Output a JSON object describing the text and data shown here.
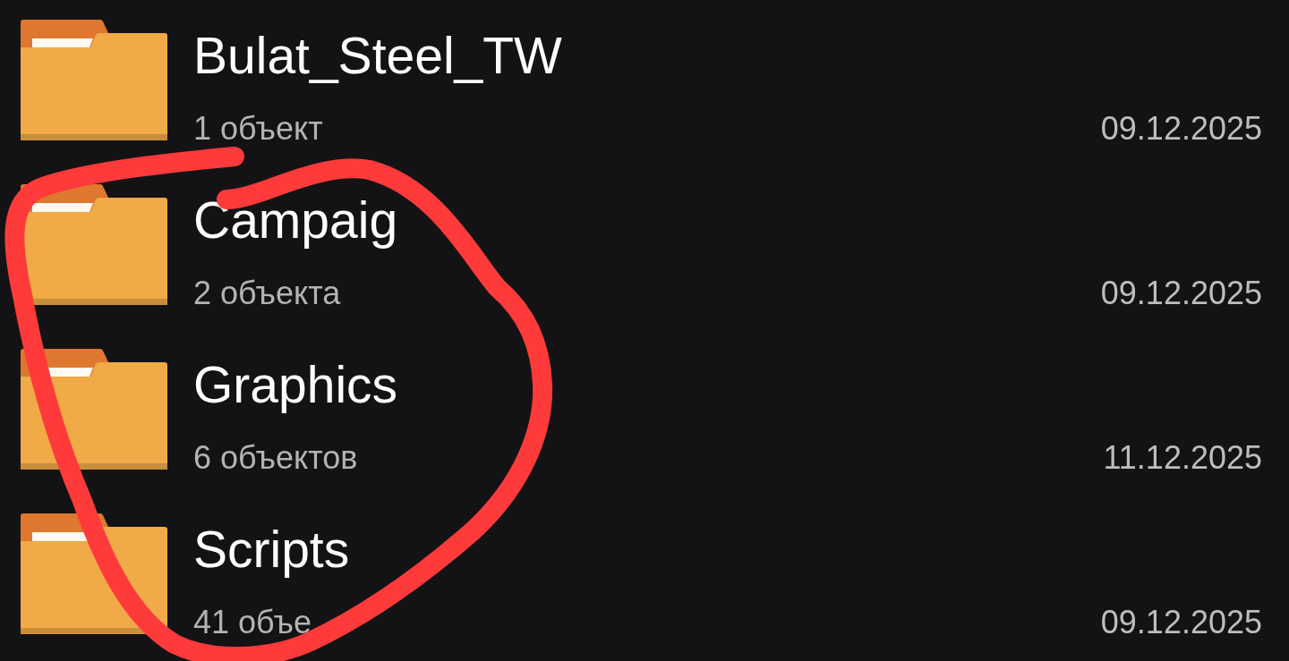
{
  "folders": [
    {
      "name": "Bulat_Steel_TW",
      "details": "1 объект",
      "date": "09.12.2025"
    },
    {
      "name": "Campaig",
      "details": "2 объекта",
      "date": "09.12.2025"
    },
    {
      "name": "Graphics",
      "details": "6 объектов",
      "date": "11.12.2025"
    },
    {
      "name": "Scripts",
      "details": "41 объе",
      "date": "09.12.2025"
    }
  ]
}
